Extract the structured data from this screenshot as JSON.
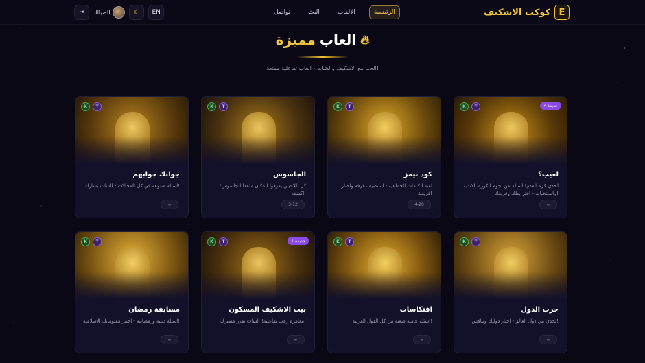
{
  "header": {
    "brand": {
      "name": "كوكب الاشكيف",
      "logo": "E"
    },
    "nav": [
      {
        "label": "الرئيسية",
        "active": true
      },
      {
        "label": "الالعاب",
        "active": false
      },
      {
        "label": "البث",
        "active": false
      },
      {
        "label": "تواصل",
        "active": false
      }
    ],
    "lang_label": "EN",
    "theme_icon": "moon-icon",
    "user_name": "الصياااد",
    "logout_icon": "logout-icon"
  },
  "hero": {
    "title_part1": "العاب",
    "title_part2": "مميزة",
    "subtitle": "العب مع الاشكيف والشات - العاب تفاعلية ممتعة!"
  },
  "games": [
    {
      "title": "لعيب؟",
      "desc": "لحدي كرة القدم! اسئلة عن نجوم الكورة، الاندية والمنتخبات - اختر بطك وفريقك!",
      "players": "∞",
      "is_new": true,
      "new_label": "جديدة"
    },
    {
      "title": "كود نيمز",
      "desc": "لعبة الكلمات الجماعية - استضيف غرفة واختار فريقك!",
      "players": "4-20",
      "is_new": false
    },
    {
      "title": "الجاسوس",
      "desc": "كل اللاعبين يعرفوا المكان ماعدا الجاسوس! اكشفه!",
      "players": "3-12",
      "is_new": false
    },
    {
      "title": "جوابك جوابهم",
      "desc": "اسئلة متنوعة في كل المجالات - الشات يشارك!",
      "players": "∞",
      "is_new": false
    },
    {
      "title": "حرب الدول",
      "desc": "لحدي بين دول العالم - اختار دولتك وتنافس!",
      "players": "∞",
      "is_new": false
    },
    {
      "title": "افتكاسات",
      "desc": "اسئلة عامية صعبة من كل الدول العربية!",
      "players": "∞",
      "is_new": false
    },
    {
      "title": "بيت الاشكيف المسكون",
      "desc": "مغامرة رعب تفاعلية! الشات يقرر مصيرك!",
      "players": "∞",
      "is_new": true,
      "new_label": "جديدة"
    },
    {
      "title": "مسابقة رمضان",
      "desc": "اسئلة دينية ورمضانية - اختبر معلوماتك الاسلامية!",
      "players": "∞",
      "is_new": false
    }
  ],
  "chip_k": "K",
  "chip_t": "T",
  "colors": {
    "accent": "#f5c73a",
    "background": "#0a0815",
    "card": "#13112a",
    "new_badge": "#8a4ae8"
  }
}
